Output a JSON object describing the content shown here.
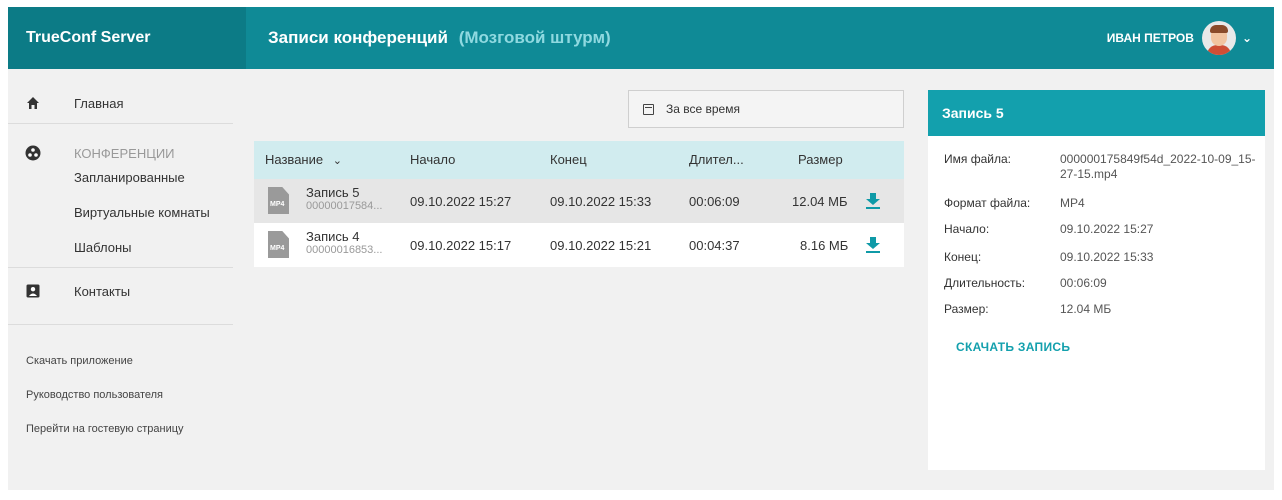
{
  "header": {
    "brand": "TrueConf Server",
    "title": "Записи конференций",
    "subtitle": "(Мозговой штурм)",
    "user_name": "ИВАН ПЕТРОВ"
  },
  "sidebar": {
    "items": [
      {
        "label": "Главная",
        "icon": "home-icon"
      },
      {
        "label": "КОНФЕРЕНЦИИ",
        "icon": "conferences-icon"
      },
      {
        "label": "Запланированные"
      },
      {
        "label": "Виртуальные комнаты"
      },
      {
        "label": "Шаблоны"
      },
      {
        "label": "Контакты",
        "icon": "contacts-icon"
      }
    ],
    "links": [
      "Скачать приложение",
      "Руководство пользователя",
      "Перейти на гостевую страницу"
    ]
  },
  "filter": {
    "label": "За все время"
  },
  "table": {
    "columns": [
      "Название",
      "Начало",
      "Конец",
      "Длител...",
      "Размер"
    ],
    "rows": [
      {
        "name": "Запись 5",
        "file": "00000017584...",
        "ext": "MP4",
        "start": "09.10.2022 15:27",
        "end": "09.10.2022 15:33",
        "duration": "00:06:09",
        "size": "12.04 МБ"
      },
      {
        "name": "Запись 4",
        "file": "00000016853...",
        "ext": "MP4",
        "start": "09.10.2022 15:17",
        "end": "09.10.2022 15:21",
        "duration": "00:04:37",
        "size": "8.16 МБ"
      }
    ]
  },
  "details": {
    "title": "Запись 5",
    "fields": [
      {
        "label": "Имя файла:",
        "value": "000000175849f54d_2022-10-09_15-27-15.mp4"
      },
      {
        "label": "Формат файла:",
        "value": "MP4"
      },
      {
        "label": "Начало:",
        "value": "09.10.2022 15:27"
      },
      {
        "label": "Конец:",
        "value": "09.10.2022 15:33"
      },
      {
        "label": "Длительность:",
        "value": "00:06:09"
      },
      {
        "label": "Размер:",
        "value": "12.04 МБ"
      }
    ],
    "action": "СКАЧАТЬ ЗАПИСЬ"
  },
  "colors": {
    "header": "#0f8a96",
    "brand_bg": "#0c7b86",
    "accent": "#13a0ad",
    "table_header": "#d1ecef"
  }
}
